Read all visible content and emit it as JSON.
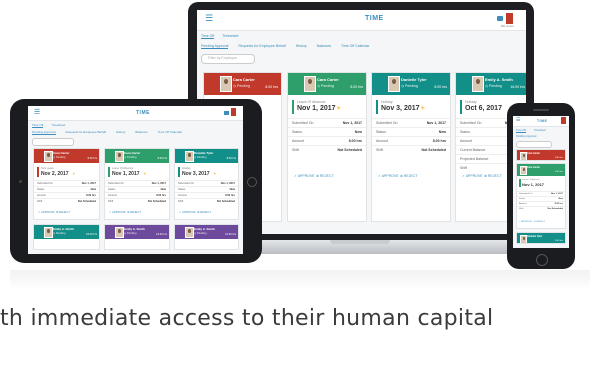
{
  "app": {
    "title": "TIME",
    "tabs": [
      "Time Off",
      "Timesheet"
    ],
    "subtabs": [
      "Pending Approval",
      "Requests for Employee Behalf",
      "History",
      "Balances",
      "Time Off Calendar"
    ],
    "filter_placeholder": "Filter by Employee",
    "user_name": "Bill Jones"
  },
  "colors": {
    "brand": "#3c8dbc",
    "card_red": "#c0392b",
    "card_green": "#2e9e6b",
    "card_teal": "#138f8a",
    "card_purple": "#6e4a9c",
    "date_accent": "#f0b429"
  },
  "cards": [
    {
      "name": "Cara Carter",
      "status": "Pending",
      "hours": "8.00 hrs",
      "date_label": "Sick Leave",
      "date": "Nov 2, 2017"
    },
    {
      "name": "Cara Carter",
      "status": "Pending",
      "hours": "8.00 hrs",
      "date_label": "Leave Of Absence",
      "date": "Nov 1, 2017"
    },
    {
      "name": "Danielle Tyler",
      "status": "Pending",
      "hours": "8.00 hrs",
      "date_label": "Holiday",
      "date": "Nov 3, 2017"
    },
    {
      "name": "Emily A. Smith",
      "status": "Pending",
      "hours": "16.00 hrs",
      "date_label": "Holiday",
      "date": "Oct 6, 2017"
    }
  ],
  "card_rows": [
    {
      "key": "Submitted On",
      "value": "Nov 1, 2017"
    },
    {
      "key": "Status",
      "value": "New"
    },
    {
      "key": "Amount",
      "value": "8.00 hrs"
    },
    {
      "key": "Shift",
      "value": "Not Scheduled"
    }
  ],
  "card4_rows": [
    {
      "key": "Submitted On",
      "value": "Nov 1, 2017"
    },
    {
      "key": "Status",
      "value": ""
    },
    {
      "key": "Amount",
      "value": ""
    },
    {
      "key": "Current Balance",
      "value": ""
    },
    {
      "key": "Projected Balance",
      "value": ""
    },
    {
      "key": "Shift",
      "value": ""
    }
  ],
  "actions": {
    "approve": "APPROVE",
    "reject": "REJECT"
  },
  "tagline": "th immediate access to their human capital"
}
